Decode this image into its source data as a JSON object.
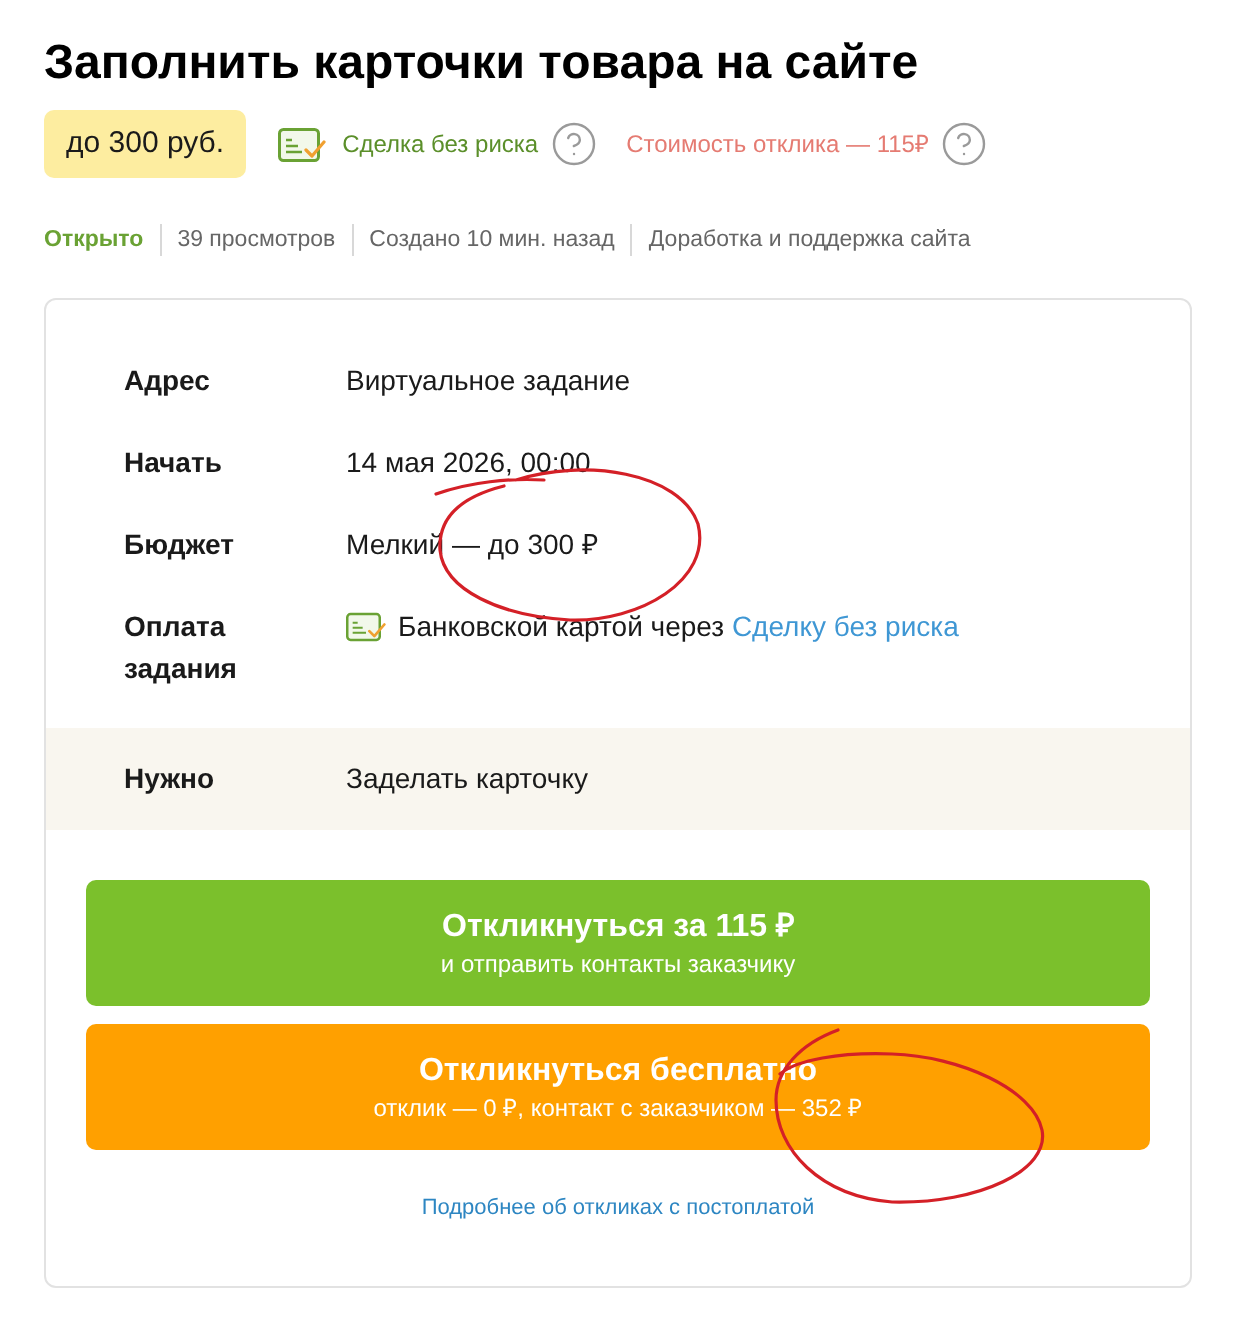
{
  "title": "Заполнить карточки товара на сайте",
  "price_badge": "до 300 руб.",
  "safe_deal": {
    "label": "Сделка без риска"
  },
  "response_cost": {
    "label": "Стоимость отклика — 115₽"
  },
  "meta": [
    {
      "text": "Открыто",
      "kind": "status"
    },
    {
      "text": "39 просмотров",
      "kind": "plain"
    },
    {
      "text": "Создано 10 мин. назад",
      "kind": "plain"
    },
    {
      "text": "Доработка и поддержка сайта",
      "kind": "plain"
    }
  ],
  "details": [
    {
      "kind": "text",
      "label": "Адрес",
      "value": "Виртуальное задание"
    },
    {
      "kind": "text",
      "label": "Начать",
      "value": "14 мая 2026, 00:00"
    },
    {
      "kind": "text",
      "label": "Бюджет",
      "value": "Мелкий — до 300 ₽"
    },
    {
      "kind": "payment",
      "label": "Оплата задания",
      "value": "Банковской картой через",
      "link": "Сделку без риска"
    }
  ],
  "requirement": {
    "label": "Нужно",
    "value": "Заделать карточку"
  },
  "buttons": [
    {
      "kind": "paid",
      "title": "Откликнуться за 115 ₽",
      "subtitle": "и отправить контакты заказчику"
    },
    {
      "kind": "free",
      "title": "Откликнуться бесплатно",
      "subtitle": "отклик — 0 ₽, контакт с заказчиком — 352 ₽"
    }
  ],
  "footer_link": "Подробнее об откликах с постоплатой"
}
